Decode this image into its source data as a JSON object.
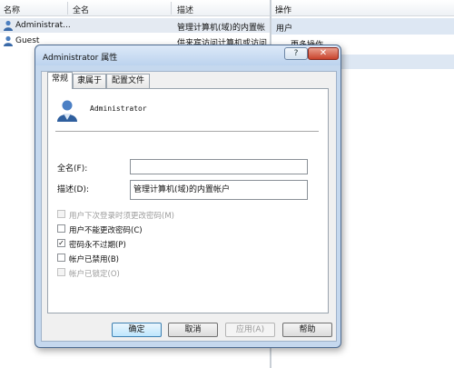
{
  "console": {
    "columns": [
      "名称",
      "全名",
      "描述"
    ],
    "users": [
      {
        "name": "Administrat...",
        "description": "管理计算机(域)的内置帐"
      },
      {
        "name": "Guest",
        "description": "供来宾访问计算机或访问"
      }
    ],
    "actions": {
      "header": "操作",
      "section": "用户",
      "more": "更多操作"
    }
  },
  "dialog": {
    "title": "Administrator 属性",
    "help_label": "?",
    "close_label": "✕",
    "tabs": [
      "常规",
      "隶属于",
      "配置文件"
    ],
    "account_name": "Administrator",
    "fields": {
      "full_name_label": "全名(F):",
      "full_name_value": "",
      "description_label": "描述(D):",
      "description_value": "管理计算机(域)的内置帐户"
    },
    "checkboxes": [
      {
        "label": "用户下次登录时须更改密码(M)",
        "checked": false,
        "disabled": true
      },
      {
        "label": "用户不能更改密码(C)",
        "checked": false,
        "disabled": false
      },
      {
        "label": "密码永不过期(P)",
        "checked": true,
        "disabled": false
      },
      {
        "label": "帐户已禁用(B)",
        "checked": false,
        "disabled": false
      },
      {
        "label": "帐户已锁定(O)",
        "checked": false,
        "disabled": true
      }
    ],
    "buttons": {
      "ok": "确定",
      "cancel": "取消",
      "apply": "应用(A)",
      "help": "帮助"
    }
  }
}
